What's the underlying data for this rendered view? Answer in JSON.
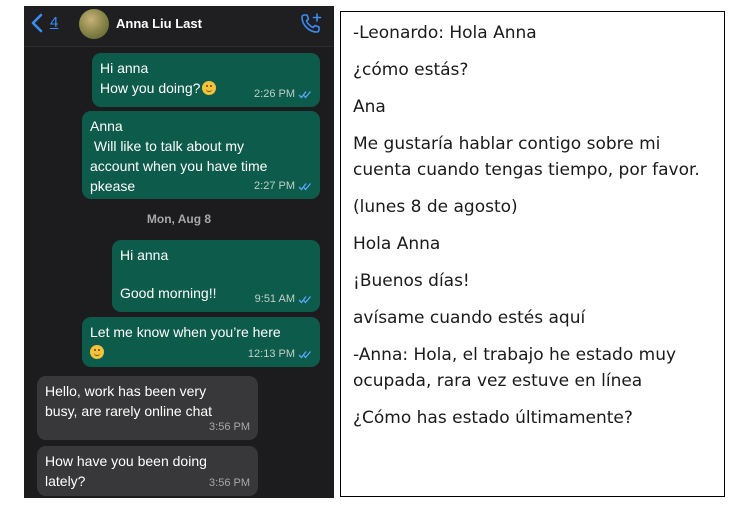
{
  "chat": {
    "back_count": "4",
    "contact_name": "Anna Liu Last",
    "date_separator": "Mon, Aug 8",
    "messages": [
      {
        "lines": [
          "Hi anna",
          "How you doing?"
        ],
        "time": "2:26 PM"
      },
      {
        "lines": [
          "Anna",
          " Will like to talk about my",
          "account when you have time",
          "pkease"
        ],
        "time": "2:27 PM"
      },
      {
        "lines": [
          "Hi anna",
          "",
          "Good morning!!"
        ],
        "time": "9:51 AM"
      },
      {
        "lines": [
          "Let me know when you’re here"
        ],
        "time": "12:13 PM"
      },
      {
        "lines": [
          "Hello, work has been very",
          "busy, are rarely online chat"
        ],
        "time": "3:56 PM"
      },
      {
        "lines": [
          "How have you been doing",
          "lately?"
        ],
        "time": "3:56 PM"
      }
    ],
    "colors": {
      "outgoing": "#0d5b4b",
      "incoming": "#38383a",
      "accent": "#3b8cf5"
    }
  },
  "translation": {
    "lines": [
      "-Leonardo: Hola Anna",
      "¿cómo estás?",
      "Ana",
      "Me gustaría hablar contigo sobre mi cuenta cuando tengas tiempo, por favor.",
      "(lunes 8 de agosto)",
      "Hola Anna",
      "¡Buenos días!",
      "avísame cuando estés aquí",
      "-Anna: Hola, el trabajo he estado muy ocupada, rara vez estuve en línea",
      "¿Cómo has estado últimamente?"
    ]
  }
}
